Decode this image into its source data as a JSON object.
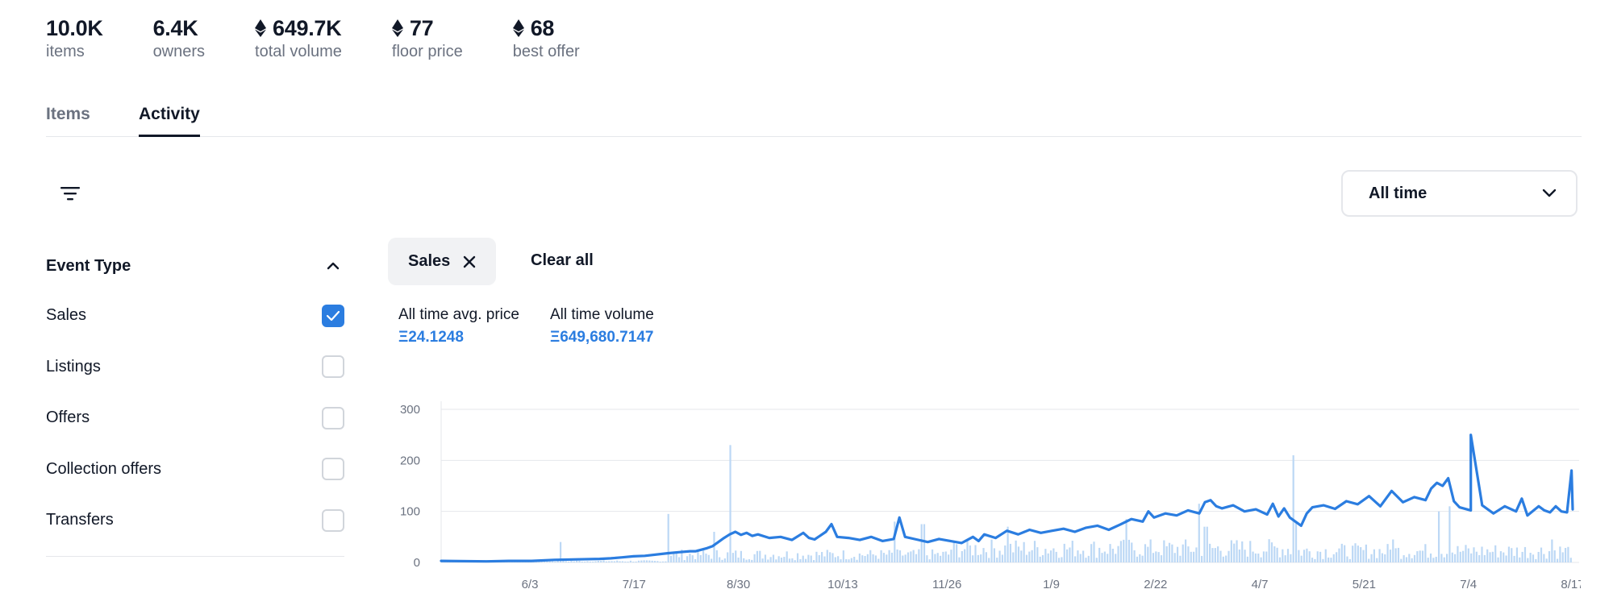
{
  "stats": [
    {
      "value": "10.0K",
      "label": "items",
      "eth": false
    },
    {
      "value": "6.4K",
      "label": "owners",
      "eth": false
    },
    {
      "value": "649.7K",
      "label": "total volume",
      "eth": true
    },
    {
      "value": "77",
      "label": "floor price",
      "eth": true
    },
    {
      "value": "68",
      "label": "best offer",
      "eth": true
    }
  ],
  "tabs": {
    "items": "Items",
    "activity": "Activity"
  },
  "time_filter": {
    "selected": "All time"
  },
  "sidebar": {
    "title": "Event Type",
    "events": [
      {
        "label": "Sales",
        "checked": true
      },
      {
        "label": "Listings",
        "checked": false
      },
      {
        "label": "Offers",
        "checked": false
      },
      {
        "label": "Collection offers",
        "checked": false
      },
      {
        "label": "Transfers",
        "checked": false
      }
    ]
  },
  "active_filters": {
    "sales_pill": "Sales",
    "clear_all": "Clear all"
  },
  "summary": {
    "avg_price_label": "All time avg. price",
    "avg_price_value": "Ξ24.1248",
    "volume_label": "All time volume",
    "volume_value": "Ξ649,680.7147"
  },
  "colors": {
    "accent": "#2b7de0",
    "bar": "#bcd8f5",
    "grid": "#e5e7eb"
  },
  "chart_data": {
    "type": "line",
    "title": "",
    "xlabel": "",
    "ylabel": "",
    "ylim": [
      0,
      300
    ],
    "yticks": [
      0,
      100,
      200,
      300
    ],
    "x_tick_labels": [
      "6/3",
      "7/17",
      "8/30",
      "10/13",
      "11/26",
      "1/9",
      "2/22",
      "4/7",
      "5/21",
      "7/4",
      "8/17"
    ],
    "series": [
      {
        "style": "line",
        "points": [
          [
            0.0,
            3
          ],
          [
            0.04,
            2
          ],
          [
            0.06,
            3
          ],
          [
            0.08,
            3
          ],
          [
            0.1,
            5
          ],
          [
            0.12,
            6
          ],
          [
            0.14,
            7
          ],
          [
            0.15,
            8
          ],
          [
            0.16,
            10
          ],
          [
            0.17,
            12
          ],
          [
            0.18,
            13
          ],
          [
            0.2,
            18
          ],
          [
            0.21,
            20
          ],
          [
            0.22,
            22
          ],
          [
            0.225,
            22
          ],
          [
            0.235,
            28
          ],
          [
            0.24,
            32
          ],
          [
            0.245,
            40
          ],
          [
            0.25,
            48
          ],
          [
            0.255,
            55
          ],
          [
            0.26,
            60
          ],
          [
            0.265,
            54
          ],
          [
            0.27,
            58
          ],
          [
            0.275,
            52
          ],
          [
            0.28,
            55
          ],
          [
            0.29,
            48
          ],
          [
            0.3,
            50
          ],
          [
            0.31,
            44
          ],
          [
            0.32,
            58
          ],
          [
            0.325,
            48
          ],
          [
            0.33,
            45
          ],
          [
            0.34,
            60
          ],
          [
            0.345,
            75
          ],
          [
            0.35,
            50
          ],
          [
            0.36,
            48
          ],
          [
            0.37,
            44
          ],
          [
            0.38,
            50
          ],
          [
            0.39,
            42
          ],
          [
            0.4,
            46
          ],
          [
            0.405,
            88
          ],
          [
            0.41,
            50
          ],
          [
            0.42,
            45
          ],
          [
            0.43,
            40
          ],
          [
            0.44,
            46
          ],
          [
            0.45,
            42
          ],
          [
            0.46,
            38
          ],
          [
            0.47,
            50
          ],
          [
            0.475,
            42
          ],
          [
            0.48,
            55
          ],
          [
            0.49,
            48
          ],
          [
            0.5,
            62
          ],
          [
            0.51,
            55
          ],
          [
            0.52,
            64
          ],
          [
            0.53,
            58
          ],
          [
            0.54,
            62
          ],
          [
            0.55,
            66
          ],
          [
            0.56,
            60
          ],
          [
            0.57,
            68
          ],
          [
            0.58,
            72
          ],
          [
            0.59,
            64
          ],
          [
            0.6,
            74
          ],
          [
            0.61,
            85
          ],
          [
            0.62,
            80
          ],
          [
            0.625,
            100
          ],
          [
            0.63,
            88
          ],
          [
            0.64,
            96
          ],
          [
            0.65,
            92
          ],
          [
            0.66,
            102
          ],
          [
            0.67,
            96
          ],
          [
            0.675,
            118
          ],
          [
            0.68,
            122
          ],
          [
            0.685,
            110
          ],
          [
            0.69,
            106
          ],
          [
            0.7,
            112
          ],
          [
            0.71,
            100
          ],
          [
            0.72,
            104
          ],
          [
            0.73,
            94
          ],
          [
            0.735,
            115
          ],
          [
            0.74,
            90
          ],
          [
            0.745,
            106
          ],
          [
            0.75,
            88
          ],
          [
            0.76,
            72
          ],
          [
            0.765,
            96
          ],
          [
            0.77,
            108
          ],
          [
            0.78,
            112
          ],
          [
            0.79,
            105
          ],
          [
            0.8,
            120
          ],
          [
            0.81,
            114
          ],
          [
            0.82,
            130
          ],
          [
            0.83,
            110
          ],
          [
            0.84,
            140
          ],
          [
            0.85,
            118
          ],
          [
            0.86,
            128
          ],
          [
            0.87,
            122
          ],
          [
            0.875,
            145
          ],
          [
            0.88,
            156
          ],
          [
            0.885,
            150
          ],
          [
            0.89,
            165
          ],
          [
            0.895,
            120
          ],
          [
            0.9,
            108
          ],
          [
            0.91,
            102
          ],
          [
            0.92,
            112
          ],
          [
            0.93,
            96
          ],
          [
            0.94,
            110
          ],
          [
            0.95,
            100
          ],
          [
            0.955,
            125
          ],
          [
            0.96,
            92
          ],
          [
            0.97,
            110
          ],
          [
            0.975,
            102
          ],
          [
            0.98,
            98
          ],
          [
            0.985,
            110
          ],
          [
            0.99,
            100
          ],
          [
            0.995,
            98
          ],
          [
            1.0,
            104
          ]
        ]
      }
    ]
  }
}
